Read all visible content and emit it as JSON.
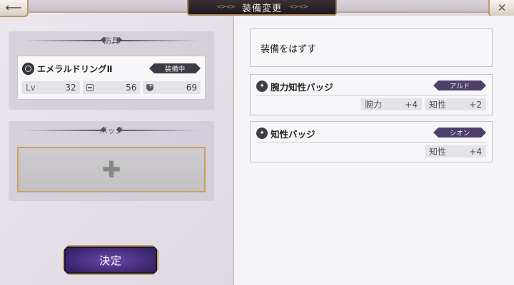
{
  "header": {
    "title": "装備変更",
    "back_icon": "arrow-left-icon",
    "close_icon": "close-icon"
  },
  "armor_section": {
    "title": "防具",
    "item": {
      "name": "エメラルドリングⅡ",
      "status": "装備中",
      "level_label": "Lv",
      "level": "32",
      "defense": "56",
      "hp": "69"
    }
  },
  "badge_section": {
    "title": "バッジ",
    "slot_icon": "plus-icon"
  },
  "confirm_button": "決定",
  "right_panel": {
    "unequip_label": "装備をはずす",
    "badges": [
      {
        "name": "腕力知性バッジ",
        "character": "アルド",
        "bonuses": [
          {
            "label": "腕力",
            "value": "+4"
          },
          {
            "label": "知性",
            "value": "+2"
          }
        ]
      },
      {
        "name": "知性バッジ",
        "character": "シオン",
        "bonuses": [
          {
            "label": "知性",
            "value": "+4"
          }
        ]
      }
    ]
  }
}
